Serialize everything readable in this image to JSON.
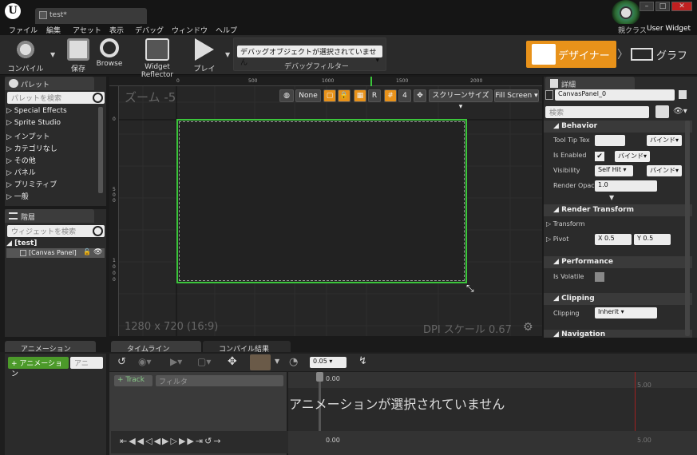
{
  "window": {
    "tab_title": "test*",
    "parent_class_label": "親クラス",
    "parent_class_value": "User Widget",
    "minimize_label": "–",
    "maximize_label": "□",
    "close_label": "✕"
  },
  "menu": [
    "ファイル",
    "編集",
    "アセット",
    "表示",
    "デバッグ",
    "ウィンドウ",
    "ヘルプ"
  ],
  "toolbar": {
    "compile_label": "コンパイル",
    "save_label": "保存",
    "browse_label": "Browse",
    "widget_reflector_label": "Widget Reflector",
    "play_label": "プレイ",
    "debug_select_value": "デバッグオブジェクトが選択されていません",
    "debug_filter_label": "デバッグフィルター",
    "designer_label": "デザイナー",
    "graph_label": "グラフ"
  },
  "palette": {
    "tab_label": "パレット",
    "search_placeholder": "パレットを検索",
    "items": [
      "Special Effects",
      "Sprite Studio",
      "インプット",
      "カテゴリなし",
      "その他",
      "パネル",
      "プリミティブ",
      "一般"
    ]
  },
  "hierarchy": {
    "tab_label": "階層",
    "search_placeholder": "ウィジェットを検索",
    "root": "[test]",
    "child": "[Canvas Panel]"
  },
  "viewport": {
    "zoom_label": "ズーム -5",
    "resolution_label": "1280 x 720 (16:9)",
    "dpi_label": "DPI スケール 0.67",
    "ruler_h": [
      "0",
      "500",
      "1000",
      "1500",
      "2000"
    ],
    "ruler_v": [
      "0",
      "5",
      "0",
      "0",
      "1",
      "0",
      "0",
      "0"
    ],
    "locale_value": "None",
    "r_label": "R",
    "grid_size": "4",
    "screen_size_label": "スクリーンサイズ",
    "fill_screen_label": "Fill Screen"
  },
  "details": {
    "tab_label": "詳細",
    "name_value": "CanvasPanel_0",
    "search_placeholder": "検索",
    "sections": {
      "behavior": "Behavior",
      "render_transform": "Render Transform",
      "performance": "Performance",
      "clipping": "Clipping",
      "navigation": "Navigation"
    },
    "tooltip_label": "Tool Tip Tex",
    "is_enabled_label": "Is Enabled",
    "visibility_label": "Visibility",
    "visibility_value": "Self Hit",
    "render_opacity_label": "Render Opac",
    "render_opacity_value": "1.0",
    "bind_label": "バインド",
    "transform_label": "Transform",
    "pivot_label": "Pivot",
    "pivot_x": "X 0.5",
    "pivot_y": "Y 0.5",
    "is_volatile_label": "Is Volatile",
    "clipping_label": "Clipping",
    "clipping_value": "Inherit"
  },
  "animations": {
    "tab_label": "アニメーション",
    "add_label": "+ アニメーション",
    "search_placeholder": "アニ"
  },
  "timeline": {
    "tab_label": "タイムライン",
    "compile_results_label": "コンパイル結果",
    "track_label": "+ Track",
    "filter_placeholder": "フィルタ",
    "time_value": "0.05",
    "start_time": "0.00",
    "end_time": "5.00",
    "empty_message": "アニメーションが選択されていません"
  }
}
